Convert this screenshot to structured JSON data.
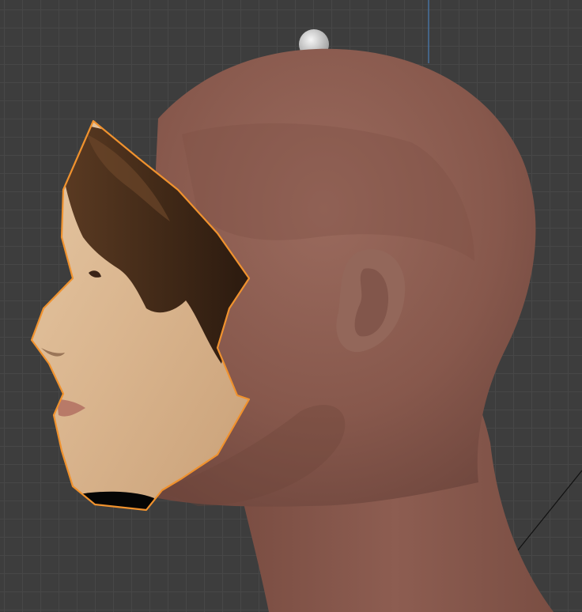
{
  "app": "3D viewport",
  "viewport": {
    "background_color": "#3d3d3d",
    "grid_color": "#474747",
    "axis_color_y": "#4a7fb8",
    "axis_line_color": "#111111"
  },
  "scene": {
    "objects": [
      {
        "name": "head-mesh",
        "skin_color": "#8a5a4e",
        "selected": false
      },
      {
        "name": "face-mask-mesh",
        "selected": true,
        "selection_outline_color": "#f0922e"
      },
      {
        "name": "light-sphere",
        "color": "#d8d8d8"
      }
    ]
  }
}
